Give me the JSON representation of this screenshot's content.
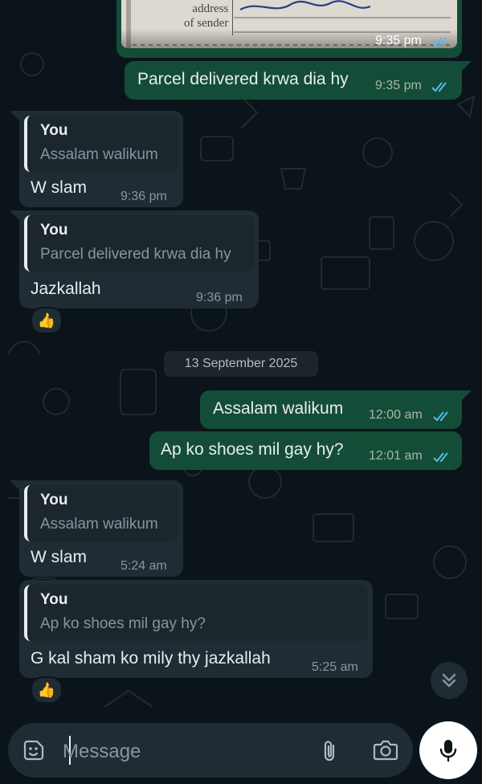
{
  "image_message": {
    "form_labels": [
      "address",
      "of sender"
    ],
    "time": "9:35 pm"
  },
  "messages": [
    {
      "id": "m1",
      "dir": "out",
      "text": "Parcel delivered krwa dia hy",
      "time": "9:35 pm"
    },
    {
      "id": "m2",
      "dir": "in",
      "quote_author": "You",
      "quote_text": "Assalam walikum",
      "text": "W slam",
      "time": "9:36 pm"
    },
    {
      "id": "m3",
      "dir": "in",
      "quote_author": "You",
      "quote_text": "Parcel delivered krwa dia hy",
      "text": "Jazkallah",
      "time": "9:36 pm",
      "reaction": "👍"
    },
    {
      "id": "m4",
      "dir": "out",
      "text": "Assalam walikum",
      "time": "12:00 am"
    },
    {
      "id": "m5",
      "dir": "out",
      "text": "Ap ko shoes mil gay hy?",
      "time": "12:01 am"
    },
    {
      "id": "m6",
      "dir": "in",
      "quote_author": "You",
      "quote_text": "Assalam walikum",
      "text": "W slam",
      "time": "5:24 am"
    },
    {
      "id": "m7",
      "dir": "in",
      "quote_author": "You",
      "quote_text": "Ap ko shoes mil gay hy?",
      "text": "G kal sham ko mily thy jazkallah",
      "time": "5:25 am",
      "reaction": "👍"
    }
  ],
  "date_divider": "13 September 2025",
  "composer": {
    "placeholder": "Message"
  },
  "icons": {
    "sticker": "sticker-icon",
    "attach": "paperclip-icon",
    "camera": "camera-icon",
    "mic": "mic-icon",
    "scroll": "double-chevron-down-icon",
    "read": "double-check-icon"
  },
  "colors": {
    "background": "#0b141a",
    "outgoing": "#144d37",
    "incoming": "#1f2c34",
    "read_tick": "#53bdeb"
  }
}
